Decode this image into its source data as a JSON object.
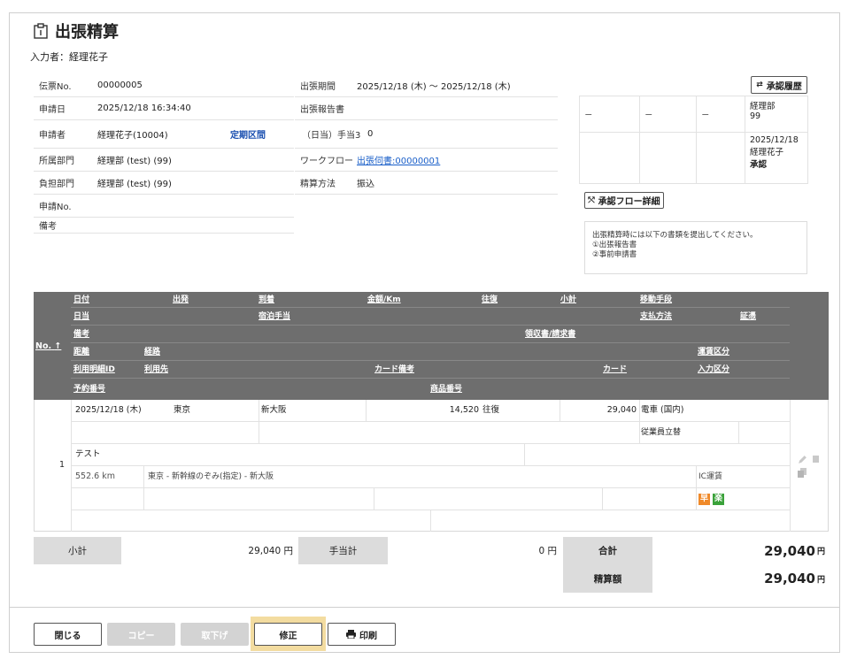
{
  "page": {
    "title": "出張精算",
    "inputter": "入力者：経理花子"
  },
  "left_info": [
    {
      "k": "伝票No.",
      "v": "00000005"
    },
    {
      "k": "申請日",
      "v": "2025/12/18 16:34:40"
    },
    {
      "k": "申請者",
      "v": "経理花子(10004)",
      "extra": "定期区間"
    },
    {
      "k": "所属部門",
      "v": "経理部 (test) (99)"
    },
    {
      "k": "負担部門",
      "v": "経理部 (test) (99)"
    },
    {
      "k": "申請No.",
      "v": ""
    },
    {
      "k": "備考",
      "v": ""
    }
  ],
  "mid_info": [
    {
      "k": "出張期間",
      "v": "2025/12/18 (木) ～ 2025/12/18 (木)"
    },
    {
      "k": "出張報告書",
      "v": ""
    },
    {
      "k": "（日当）手当3",
      "v": "0"
    },
    {
      "k": "ワークフロー",
      "v": "出張伺書:00000001"
    },
    {
      "k": "精算方法",
      "v": "振込"
    }
  ],
  "approval": {
    "history_button": "承認履歴",
    "flow_button": "承認フロー詳細",
    "dash": "－",
    "dept": "経理部",
    "dept_code": "99",
    "date": "2025/12/18",
    "approver": "経理花子",
    "status": "承認"
  },
  "note": [
    "出張精算時には以下の書類を提出してください。",
    "①出張報告書",
    "②事前申請書"
  ],
  "grid_header": {
    "no": "No.",
    "sort_icon": "↑",
    "row1": [
      "日付",
      "出発",
      "到着",
      "金額/Km",
      "往復",
      "小計",
      "移動手段"
    ],
    "row2": [
      "日当",
      "宿泊手当",
      "支払方法",
      "証憑"
    ],
    "row3": [
      "備考",
      "領収書/請求書"
    ],
    "row4": [
      "距離",
      "経路",
      "運賃区分"
    ],
    "row5": [
      "利用明細ID",
      "利用先",
      "カード備考",
      "カード",
      "入力区分"
    ],
    "row6": [
      "予約番号",
      "商品番号"
    ]
  },
  "grid_row": {
    "no": "1",
    "date": "2025/12/18 (木)",
    "from": "東京",
    "to": "新大阪",
    "amount": "14,520",
    "roundtrip": "往復",
    "subtotal": "29,040",
    "transport": "電車 (国内)",
    "payment": "従業員立替",
    "remarks": "テスト",
    "distance": "552.6 km",
    "route": "東京 - 新幹線のぞみ(指定) - 新大阪",
    "fare_type": "IC運賃",
    "badge1": "早",
    "badge2": "楽"
  },
  "totals": {
    "subtotal_label": "小計",
    "subtotal_value": "29,040 円",
    "allowance_label": "手当計",
    "allowance_value": "0 円",
    "total_label": "合計",
    "total_value": "29,040",
    "settle_label": "精算額",
    "settle_value": "29,040",
    "unit": "円"
  },
  "footer": {
    "close": "閉じる",
    "copy": "コピー",
    "withdraw": "取下げ",
    "edit": "修正",
    "print": "印刷"
  },
  "colors": {
    "header_gray": "#6e6e6e",
    "badge_orange": "#f08a2a",
    "badge_green": "#3aa23a",
    "highlight": "#f3dca0"
  }
}
